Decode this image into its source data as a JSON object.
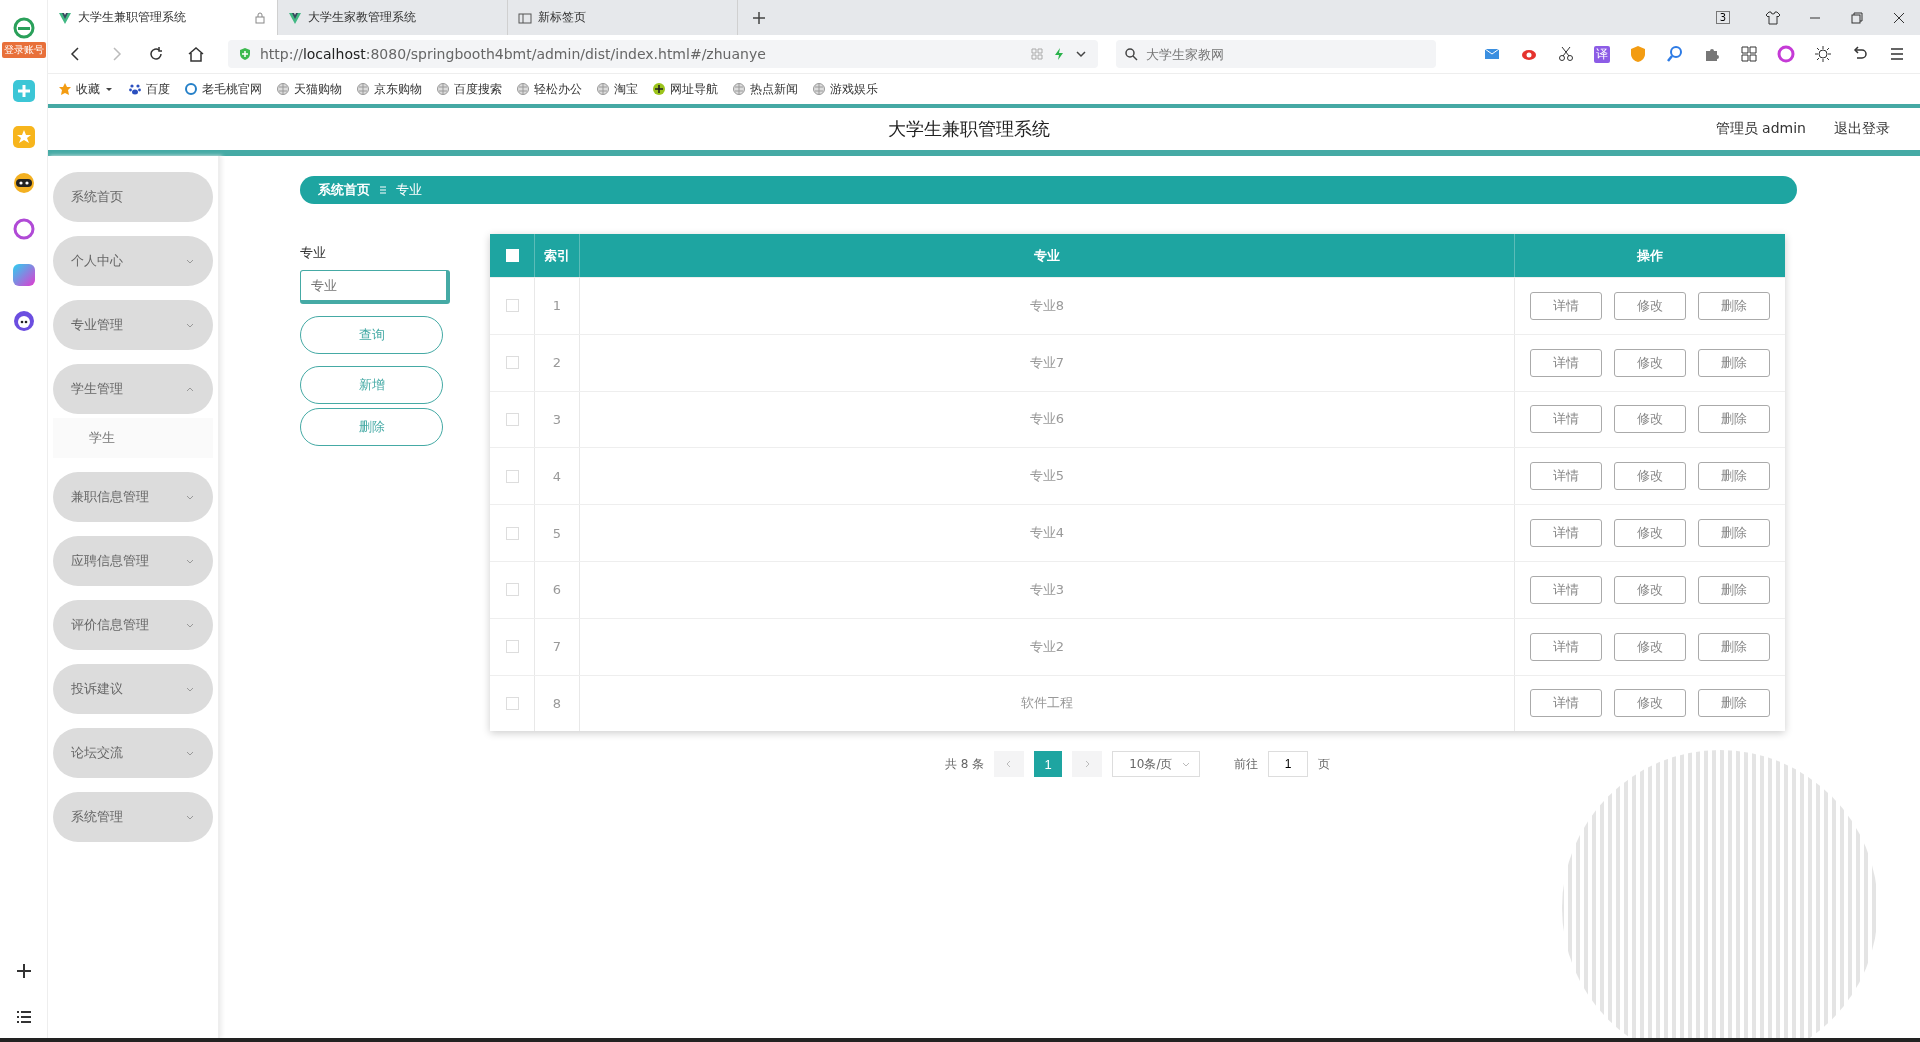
{
  "browser": {
    "login_badge": "登录账号",
    "tabs": [
      {
        "title": "大学生兼职管理系统",
        "selected": true,
        "locked": true
      },
      {
        "title": "大学生家教管理系统",
        "selected": false,
        "locked": false
      },
      {
        "title": "新标签页",
        "selected": false,
        "locked": false
      }
    ],
    "tab_count": "3",
    "address": {
      "scheme": "http://",
      "host": "localhost",
      "rest": ":8080/springbooth4bmt/admin/dist/index.html#/zhuanye"
    },
    "search_placeholder": "大学生家教网",
    "translate_label": "译",
    "bookmarks": [
      {
        "label": "收藏",
        "kind": "star"
      },
      {
        "label": "百度",
        "kind": "paw"
      },
      {
        "label": "老毛桃官网",
        "kind": "ring"
      },
      {
        "label": "天猫购物",
        "kind": "globe"
      },
      {
        "label": "京东购物",
        "kind": "globe"
      },
      {
        "label": "百度搜索",
        "kind": "globe"
      },
      {
        "label": "轻松办公",
        "kind": "globe"
      },
      {
        "label": "淘宝",
        "kind": "globe"
      },
      {
        "label": "网址导航",
        "kind": "plus"
      },
      {
        "label": "热点新闻",
        "kind": "globe"
      },
      {
        "label": "游戏娱乐",
        "kind": "globe"
      }
    ]
  },
  "app": {
    "title": "大学生兼职管理系统",
    "user": "管理员 admin",
    "logout": "退出登录"
  },
  "sidebar": {
    "items": [
      {
        "label": "系统首页",
        "kind": "link"
      },
      {
        "label": "个人中心",
        "kind": "menu",
        "expanded": false
      },
      {
        "label": "专业管理",
        "kind": "menu",
        "expanded": false
      },
      {
        "label": "学生管理",
        "kind": "menu",
        "expanded": true,
        "children": [
          {
            "label": "学生"
          }
        ]
      },
      {
        "label": "兼职信息管理",
        "kind": "menu",
        "expanded": false
      },
      {
        "label": "应聘信息管理",
        "kind": "menu",
        "expanded": false
      },
      {
        "label": "评价信息管理",
        "kind": "menu",
        "expanded": false
      },
      {
        "label": "投诉建议",
        "kind": "menu",
        "expanded": false
      },
      {
        "label": "论坛交流",
        "kind": "menu",
        "expanded": false
      },
      {
        "label": "系统管理",
        "kind": "menu",
        "expanded": false
      }
    ]
  },
  "breadcrumb": [
    "系统首页",
    "专业"
  ],
  "search": {
    "label": "专业",
    "placeholder": "专业",
    "buttons": [
      "查询",
      "新增",
      "删除"
    ]
  },
  "table": {
    "all_checked": false,
    "columns": [
      "索引",
      "专业",
      "操作"
    ],
    "rows": [
      {
        "index": "1",
        "name": "专业8",
        "checked": false,
        "actions": [
          "详情",
          "修改",
          "删除"
        ]
      },
      {
        "index": "2",
        "name": "专业7",
        "checked": false,
        "actions": [
          "详情",
          "修改",
          "删除"
        ]
      },
      {
        "index": "3",
        "name": "专业6",
        "checked": false,
        "actions": [
          "详情",
          "修改",
          "删除"
        ]
      },
      {
        "index": "4",
        "name": "专业5",
        "checked": false,
        "actions": [
          "详情",
          "修改",
          "删除"
        ]
      },
      {
        "index": "5",
        "name": "专业4",
        "checked": false,
        "actions": [
          "详情",
          "修改",
          "删除"
        ]
      },
      {
        "index": "6",
        "name": "专业3",
        "checked": false,
        "actions": [
          "详情",
          "修改",
          "删除"
        ]
      },
      {
        "index": "7",
        "name": "专业2",
        "checked": false,
        "actions": [
          "详情",
          "修改",
          "删除"
        ]
      },
      {
        "index": "8",
        "name": "软件工程",
        "checked": false,
        "actions": [
          "详情",
          "修改",
          "删除"
        ]
      }
    ]
  },
  "pagination": {
    "total": "共 8 条",
    "pages": [
      {
        "label": "1",
        "selected": true
      }
    ],
    "page_size": "10条/页",
    "goto_label": "前往",
    "goto_value": "1",
    "goto_suffix": "页"
  }
}
